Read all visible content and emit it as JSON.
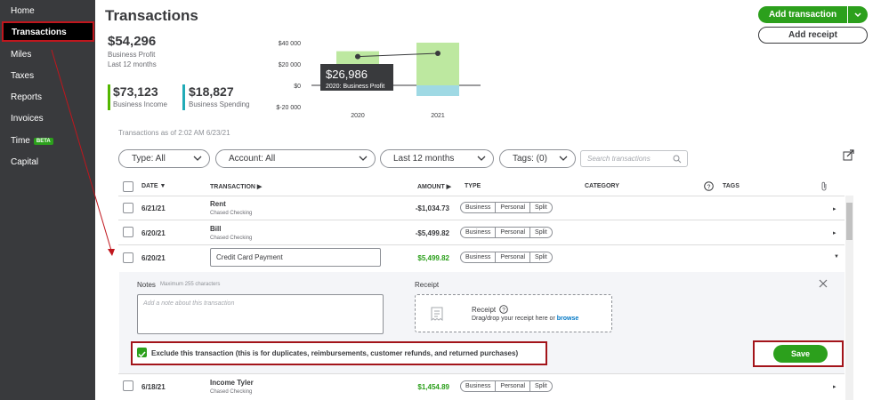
{
  "sidebar": {
    "items": [
      {
        "label": "Home"
      },
      {
        "label": "Transactions"
      },
      {
        "label": "Miles"
      },
      {
        "label": "Taxes"
      },
      {
        "label": "Reports"
      },
      {
        "label": "Invoices"
      },
      {
        "label": "Time",
        "badge": "BETA"
      },
      {
        "label": "Capital"
      }
    ]
  },
  "header": {
    "title": "Transactions",
    "add_transaction": "Add transaction",
    "add_receipt": "Add receipt"
  },
  "summary": {
    "profit_value": "$54,296",
    "profit_label": "Business Profit",
    "profit_period": "Last 12 months",
    "income_value": "$73,123",
    "income_label": "Business Income",
    "spending_value": "$18,827",
    "spending_label": "Business Spending"
  },
  "chart_data": {
    "type": "bar",
    "categories": [
      "2020",
      "2021"
    ],
    "series": [
      {
        "name": "Business Income",
        "values": [
          32000,
          40000
        ],
        "color": "#bde8a0"
      },
      {
        "name": "Business Spending",
        "values": [
          -5000,
          -10000
        ],
        "color": "#9fd9e4"
      },
      {
        "name": "Business Profit",
        "values": [
          26986,
          30000
        ],
        "color": "#393a3d"
      }
    ],
    "yticks": [
      "$40 000",
      "$20 000",
      "$0",
      "$-20 000"
    ],
    "ylim": [
      -20000,
      40000
    ],
    "tooltip_value": "$26,986",
    "tooltip_label": "2020: Business Profit"
  },
  "as_of": "Transactions as of 2:02 AM 6/23/21",
  "filters": {
    "type": "Type: All",
    "account": "Account: All",
    "period": "Last 12 months",
    "tags": "Tags: (0)",
    "search_placeholder": "Search transactions"
  },
  "table": {
    "headers": {
      "date": "DATE",
      "transaction": "TRANSACTION",
      "amount": "AMOUNT",
      "type": "TYPE",
      "category": "CATEGORY",
      "tags": "TAGS"
    },
    "type_options": [
      "Business",
      "Personal",
      "Split"
    ],
    "rows": [
      {
        "date": "6/21/21",
        "name": "Rent",
        "account": "Chased Checking",
        "amount": "-$1,034.73"
      },
      {
        "date": "6/20/21",
        "name": "Bill",
        "account": "Chased Checking",
        "amount": "-$5,499.82"
      },
      {
        "date": "6/20/21",
        "name": "Credit Card Payment",
        "account": "",
        "amount": "$5,499.82"
      },
      {
        "date": "6/18/21",
        "name": "Income Tyler",
        "account": "Chased Checking",
        "amount": "$1,454.89"
      }
    ]
  },
  "expanded": {
    "notes_label": "Notes",
    "notes_max": "Maximum 255 characters",
    "notes_placeholder": "Add a note about this transaction",
    "receipt_label": "Receipt",
    "receipt_title": "Receipt",
    "receipt_drag": "Drag/drop your receipt here or ",
    "receipt_browse": "browse",
    "exclude_label": "Exclude this transaction (this is for duplicates, reimbursements, customer refunds, and returned purchases)",
    "save": "Save"
  }
}
